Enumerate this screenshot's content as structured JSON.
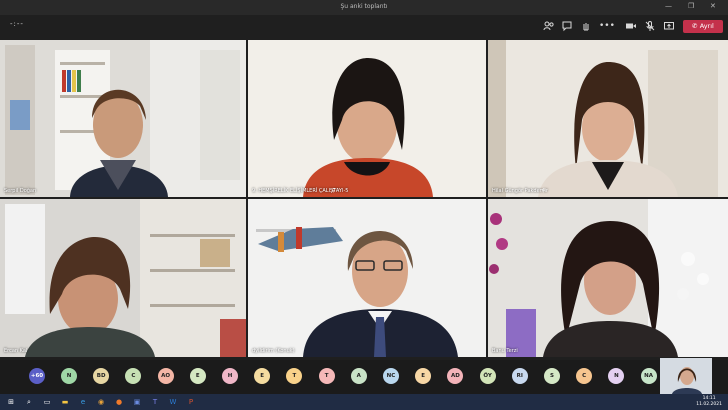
{
  "window": {
    "title": "Şu anki toplantı",
    "minimize": "—",
    "maximize": "❐",
    "close": "✕"
  },
  "toolbar": {
    "timer": "-:--",
    "icons": [
      "people-icon",
      "chat-icon",
      "raise-hand-icon",
      "reactions-icon",
      "more-icon",
      "camera-icon",
      "mic-icon",
      "share-icon",
      "leave"
    ],
    "leave_label": "Ayrıl"
  },
  "tiles": [
    {
      "name": "Serpil Doğan",
      "pinned": false
    },
    {
      "name": "9. HEMŞİRELİK ELİŞİMLERİ ÇALIŞTAYI-5",
      "pinned": true
    },
    {
      "name": "Hilal Güngör Pakdemir",
      "pinned": true
    },
    {
      "name": "Ercan Kal",
      "pinned": false
    },
    {
      "name": "dyildirim (Konuk)",
      "pinned": false
    },
    {
      "name": "Banu Terzi",
      "pinned": false
    }
  ],
  "participants": {
    "more": "+60",
    "initials": [
      "N",
      "BD",
      "C",
      "AO",
      "E",
      "H",
      "E",
      "T",
      "T",
      "A",
      "NC",
      "E",
      "AD",
      "ÖY",
      "RI",
      "S",
      "C",
      "N",
      "NA"
    ],
    "colors": [
      "#9fd7a6",
      "#e7d6a3",
      "#c6e0b4",
      "#f4b6a6",
      "#d4e8c2",
      "#f0b7c8",
      "#f5dca0",
      "#f9d28a",
      "#f5b8b8",
      "#c9e3c7",
      "#b9d7ee",
      "#f7d7a5",
      "#f3b3b9",
      "#d2e4b8",
      "#c8d9ef",
      "#d5e8c6",
      "#f6c58f",
      "#e4d0f1",
      "#c7e5c9"
    ]
  },
  "taskbar": {
    "icons": [
      "windows-icon",
      "search-icon",
      "task-view-icon",
      "file-explorer-icon",
      "edge-icon",
      "chrome-icon",
      "firefox-icon",
      "store-icon",
      "teams-icon",
      "word-icon",
      "powerpoint-icon"
    ],
    "time": "14:11",
    "date": "11.02.2021"
  }
}
